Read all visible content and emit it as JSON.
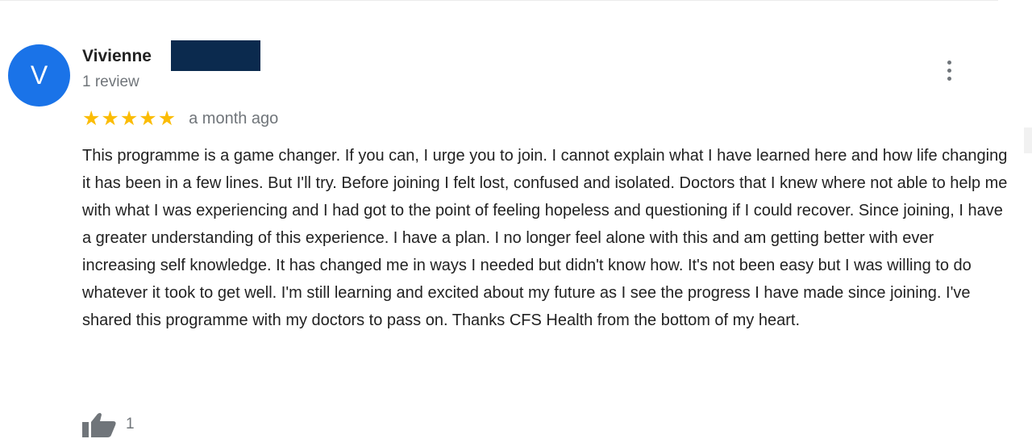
{
  "review": {
    "avatar_letter": "V",
    "reviewer_name": "Vivienne",
    "review_count": "1 review",
    "rating": 5,
    "rating_max": 5,
    "date": "a month ago",
    "text": "This programme is a game changer. If you can, I urge you to join. I cannot explain what I have learned here and how life changing it has been in a few lines. But I'll try. Before joining I felt lost, confused and isolated. Doctors that I knew where not able to help me with what I was experiencing and I had got to the point of feeling hopeless and questioning if I could recover. Since joining, I have a greater understanding of this experience. I have a plan. I no longer feel alone with this and am getting better with ever increasing self knowledge. It has changed me in ways I needed but didn't know how. It's not been easy but I was willing to do whatever it took to get well. I'm still learning and excited about my future as I see the progress I have made since joining. I've shared this programme with my doctors to pass on. Thanks CFS Health from the bottom of my heart.",
    "like_count": "1",
    "icons": {
      "more": "more-vertical-icon",
      "like": "thumbs-up-icon",
      "star": "star-icon"
    }
  },
  "colors": {
    "avatar_bg": "#1a73e8",
    "star": "#fbbc04",
    "secondary_text": "#70757a",
    "redaction": "#0b2a4e"
  }
}
